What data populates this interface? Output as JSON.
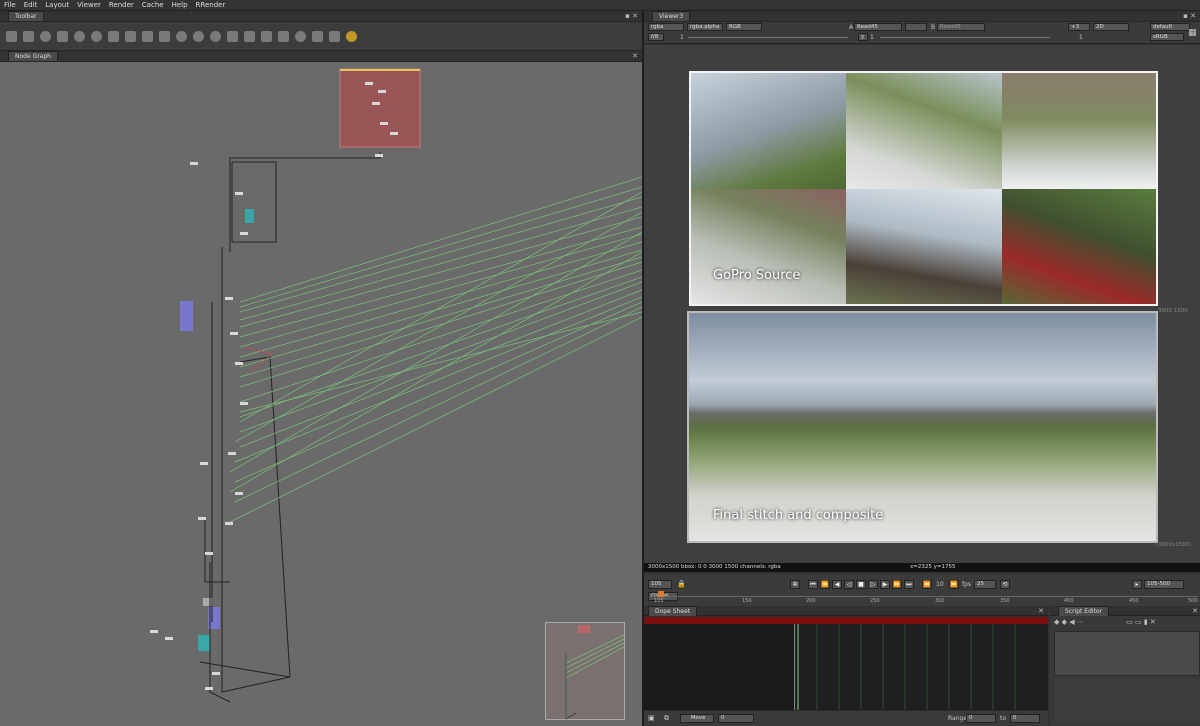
{
  "menu": [
    "File",
    "Edit",
    "Layout",
    "Viewer",
    "Render",
    "Cache",
    "Help",
    "RRender"
  ],
  "left": {
    "toolbar_tab": "Toolbar",
    "graph_tab": "Node Graph"
  },
  "viewer": {
    "tab": "Viewer3",
    "channels": "rgba",
    "alpha": "rgba.alpha",
    "colorspace": "RGB",
    "a_label": "A",
    "a_input": "Read45",
    "b_label": "B",
    "b_input": "Read45",
    "zoom": "+3",
    "view_mode": "2D",
    "lut": "default",
    "display": "sRGB",
    "gain_label": "f/8",
    "gain_value": "1",
    "gamma_label": "y",
    "gamma_value": "1",
    "frame_val": "1",
    "top_label": "GoPro Source",
    "bottom_label": "Final stitch and composite",
    "res_top": "3000,1500",
    "res_bottom": "(3000x1500)",
    "info": "3000x1500 bbox: 0 0 3000 1500 channels: rgba",
    "coords": "x=2325 y=1755"
  },
  "transport": {
    "current_frame": "105",
    "scope": "Global",
    "increment": "10",
    "fps_label": "fps",
    "fps": "25",
    "range": "105-500",
    "ruler_ticks": [
      "105",
      "150",
      "200",
      "250",
      "300",
      "350",
      "400",
      "450",
      "500"
    ]
  },
  "dopesheet": {
    "tab": "Dope Sheet",
    "move_label": "Move",
    "move_value": "0",
    "range_label": "Range",
    "range_from": "0",
    "to_label": "to",
    "range_to": "0",
    "ticks": [
      "0",
      "10",
      "20",
      "30",
      "40",
      "50",
      "60",
      "70",
      "80",
      "90",
      "100"
    ]
  },
  "script_editor": {
    "tab": "Script Editor"
  }
}
